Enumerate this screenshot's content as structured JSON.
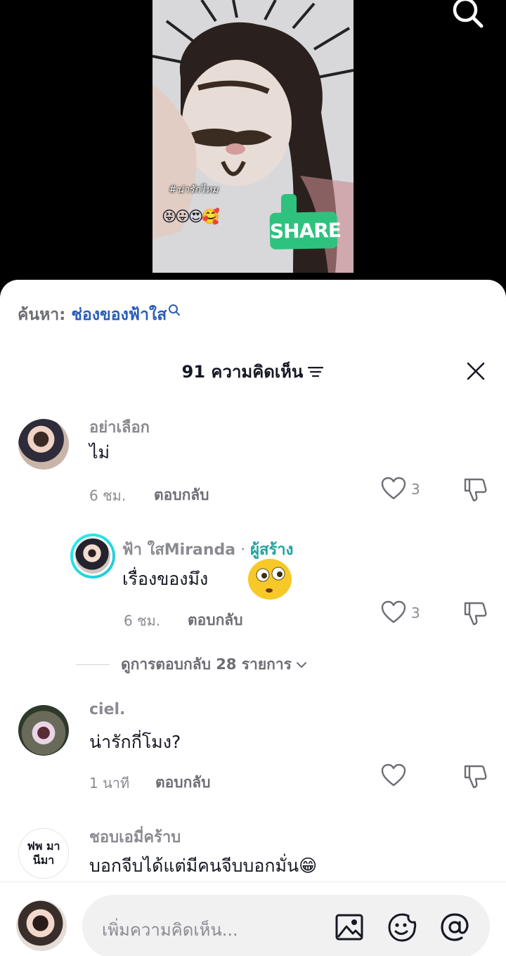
{
  "video": {
    "caption": "#น่ารักไหม",
    "emojis": "😝😛😍🥰",
    "sticker_label": "SHARE"
  },
  "search_suggestion": {
    "prefix": "ค้นหา:",
    "term": "ช่องของฟ้าใส"
  },
  "header": {
    "title": "91 ความคิดเห็น"
  },
  "comments": [
    {
      "author": "อย่าเลือก",
      "text": "ไม่",
      "time": "6 ชม.",
      "reply_label": "ตอบกลับ",
      "likes": "3"
    },
    {
      "author": "ฟ้า ใสMiranda",
      "author_sep": " · ",
      "author_badge": "ผู้สร้าง",
      "text": "เรื่องของมึง",
      "time": "6 ชม.",
      "reply_label": "ตอบกลับ",
      "likes": "3"
    },
    {
      "author": "ciel.",
      "text": "น่ารักกี่โมง?",
      "time": "1 นาที",
      "reply_label": "ตอบกลับ"
    },
    {
      "author": "ชอบเอมี่คร้าบ",
      "avatar_text_1": "ฟพ มา",
      "avatar_text_2": "นีมา",
      "text": "บอกจีบได้แต่มีคนจีบบอกมั่น😁"
    }
  ],
  "view_replies": "ดูการตอบกลับ 28 รายการ",
  "input": {
    "placeholder": "เพิ่มความคิดเห็น..."
  },
  "colors": {
    "creator_badge": "#20a39e",
    "search_term": "#2b5db9",
    "share_sticker": "#2ec27e"
  }
}
